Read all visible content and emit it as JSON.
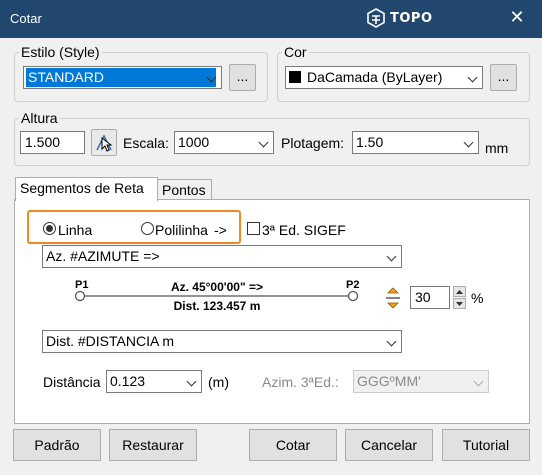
{
  "window": {
    "title": "Cotar",
    "brand": "TOPO",
    "close_glyph": "✕"
  },
  "style_group": {
    "label": "Estilo (Style)",
    "value": "STANDARD",
    "browse_label": "..."
  },
  "color_group": {
    "label": "Cor",
    "value": "DaCamada (ByLayer)",
    "swatch": "#000000",
    "browse_label": "..."
  },
  "height_group": {
    "label": "Altura",
    "height_value": "1.500",
    "pick_icon": "pick-point-icon",
    "scale_label": "Escala:",
    "scale_value": "1000",
    "plot_label": "Plotagem:",
    "plot_value": "1.50",
    "unit": "mm"
  },
  "tabs": [
    {
      "label": "Segmentos de Reta",
      "active": true
    },
    {
      "label": "Pontos",
      "active": false
    }
  ],
  "segment_tab": {
    "radio_line": {
      "label": "Linha",
      "selected": true
    },
    "radio_polyline": {
      "label": "Polilinha",
      "arrow": "->",
      "selected": false
    },
    "sigef": {
      "label": "3ª Ed. SIGEF",
      "checked": false
    },
    "azimuth_format": "Az.  #AZIMUTE =>",
    "preview": {
      "p1": "P1",
      "p2": "P2",
      "az_text": "Az.  45°00'00\" =>",
      "dist_text": "Dist.  123.457 m"
    },
    "offset_value": "30",
    "offset_unit": "%",
    "distance_format": "Dist. #DISTANCIA m",
    "distance_label": "Distância",
    "distance_value": "0.123",
    "distance_unit": "(m)",
    "azim_label": "Azim. 3ªEd.:",
    "azim_value": "GGGºMM'"
  },
  "buttons": {
    "default": "Padrão",
    "restore": "Restaurar",
    "dimension": "Cotar",
    "cancel": "Cancelar",
    "tutorial": "Tutorial"
  },
  "colors": {
    "titlebar": "#21476f",
    "highlight": "#f08a1c",
    "selection": "#0078d7"
  }
}
